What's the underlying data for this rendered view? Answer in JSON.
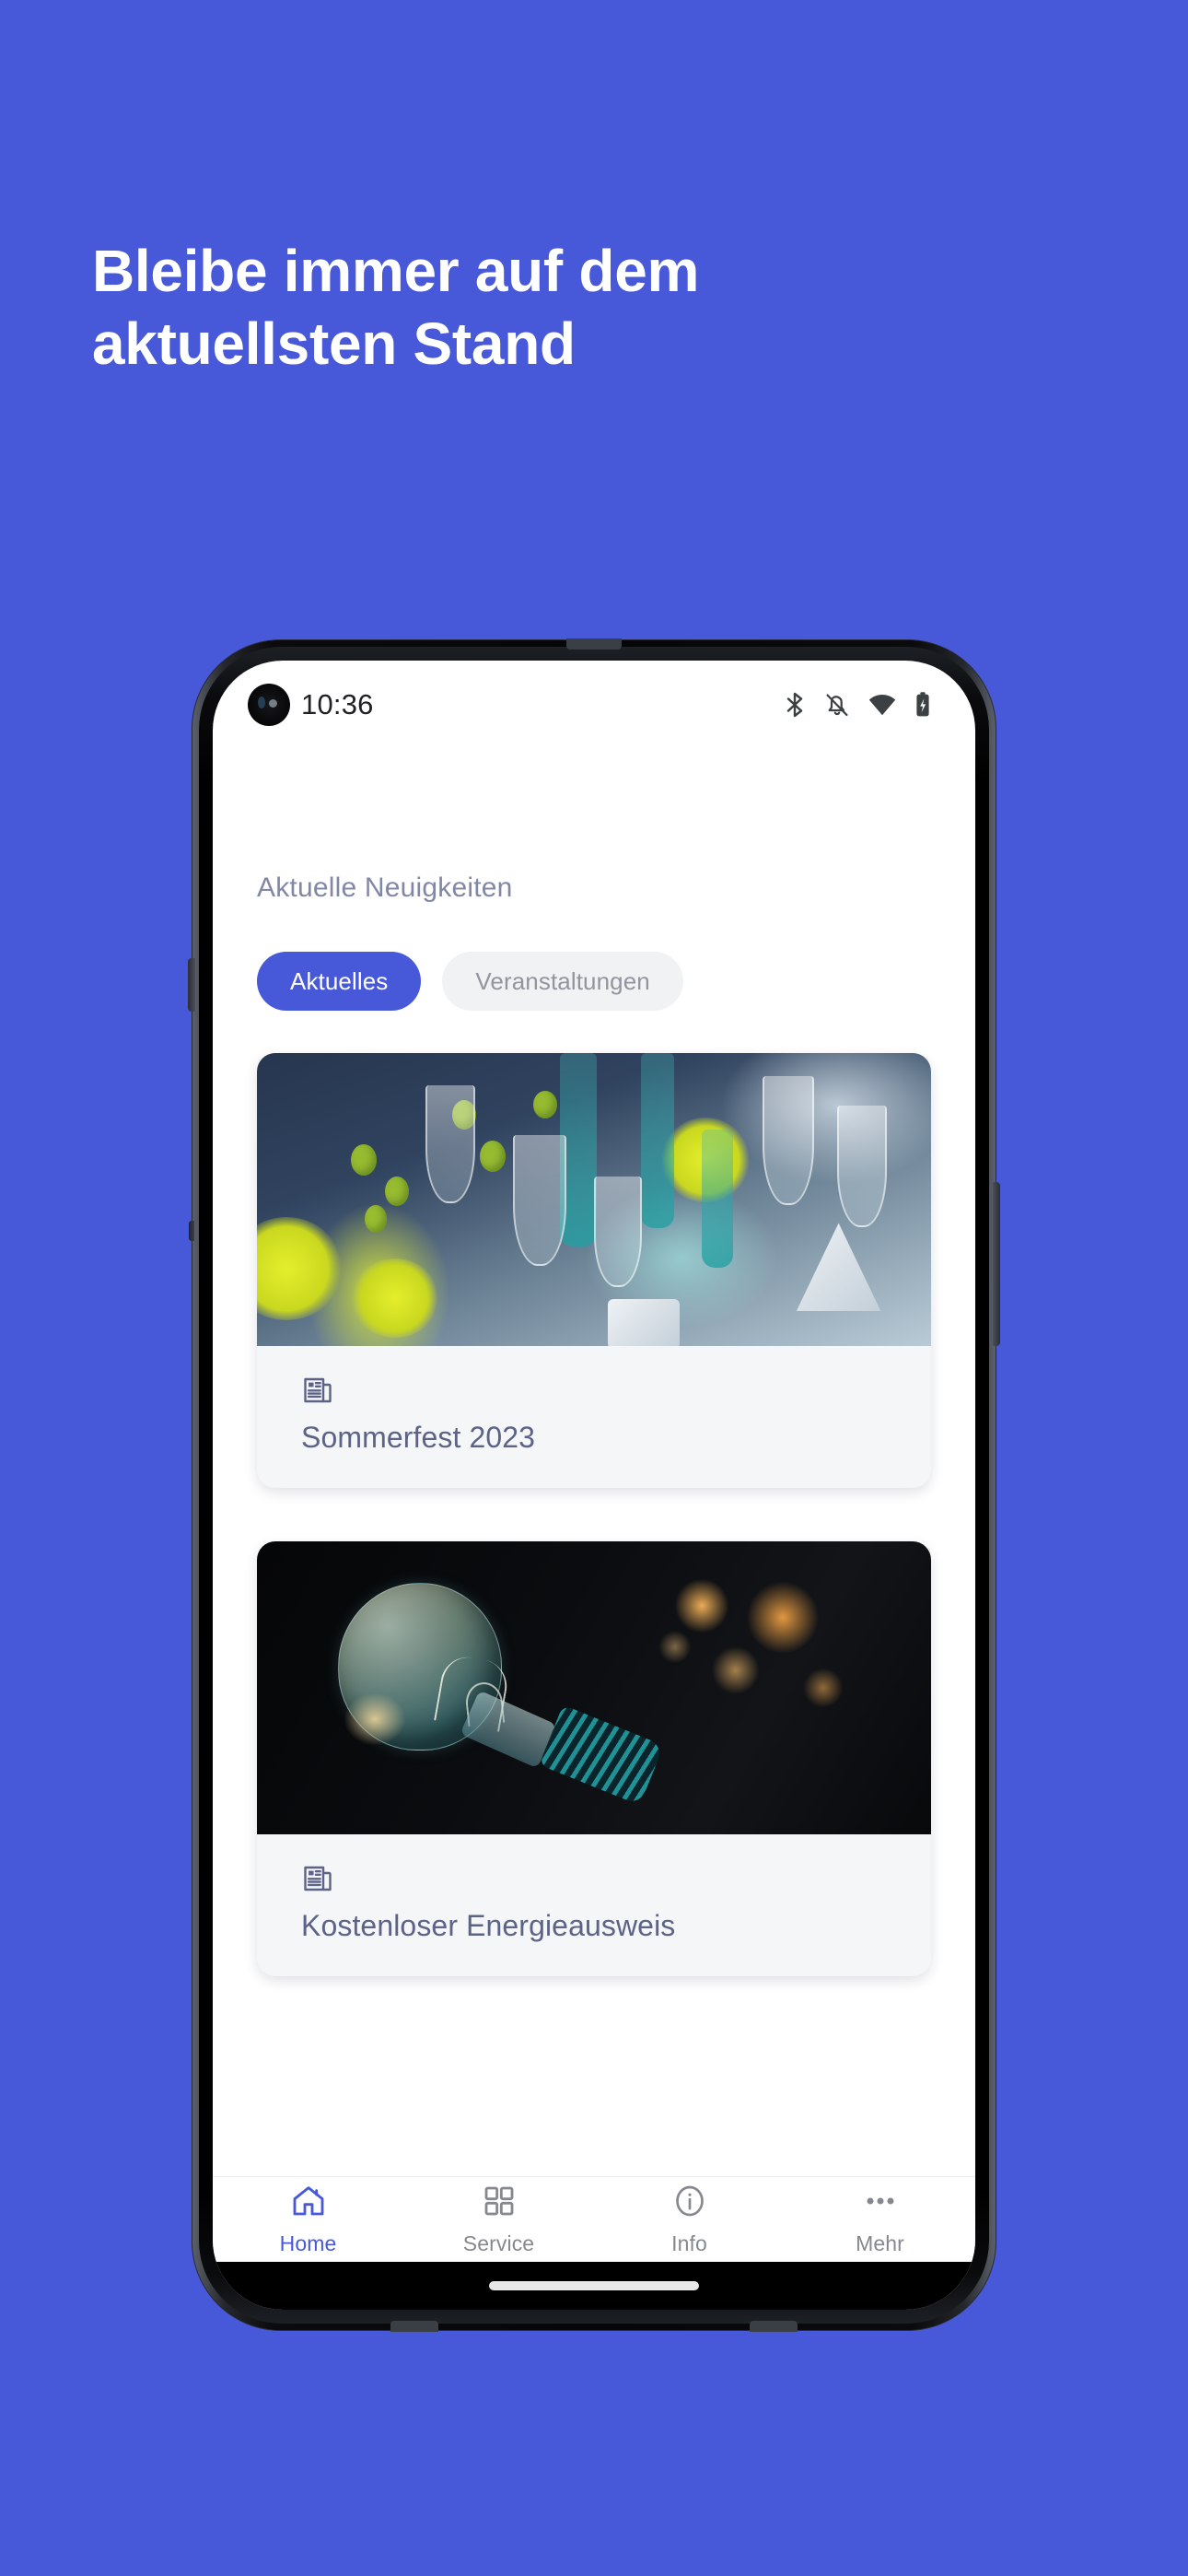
{
  "promo": {
    "headline_line1": "Bleibe immer auf dem",
    "headline_line2": "aktuellsten Stand",
    "background_color": "#4759D8",
    "text_color": "#FFFFFF"
  },
  "status_bar": {
    "time": "10:36",
    "icons": [
      "bluetooth-icon",
      "notifications-silenced-icon",
      "wifi-icon",
      "battery-charging-icon"
    ]
  },
  "screen": {
    "section_title": "Aktuelle Neuigkeiten",
    "filter_chips": [
      {
        "label": "Aktuelles",
        "active": true
      },
      {
        "label": "Veranstaltungen",
        "active": false
      }
    ],
    "cards": [
      {
        "title": "Sommerfest 2023",
        "icon": "newspaper-icon",
        "image_alt": "festive-table-setting-with-glasses-and-greenery"
      },
      {
        "title": "Kostenloser Energieausweis",
        "icon": "newspaper-icon",
        "image_alt": "light-bulb-with-warm-bokeh-lights"
      }
    ]
  },
  "bottom_nav": {
    "items": [
      {
        "label": "Home",
        "icon": "house-icon",
        "active": true
      },
      {
        "label": "Service",
        "icon": "grid-icon",
        "active": false
      },
      {
        "label": "Info",
        "icon": "info-circle-icon",
        "active": false
      },
      {
        "label": "Mehr",
        "icon": "ellipsis-icon",
        "active": false
      }
    ],
    "active_color": "#4759D8",
    "inactive_color": "#85898F"
  },
  "colors": {
    "accent": "#4759D8",
    "card_bg": "#F4F6F8",
    "card_title": "#5C6386",
    "section_title": "#8287A6",
    "chip_inactive_bg": "#F1F2F4",
    "chip_inactive_text": "#91959D"
  }
}
